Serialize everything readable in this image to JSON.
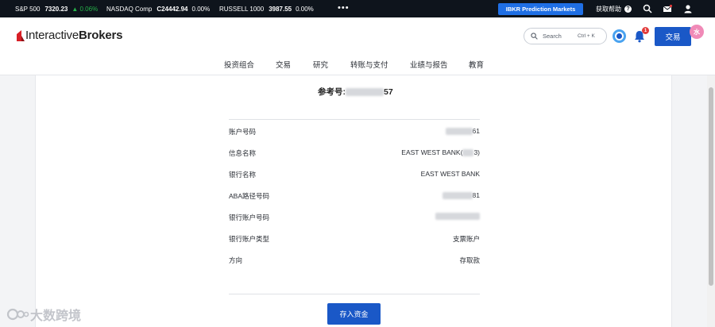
{
  "ticker": [
    {
      "name": "S&P 500",
      "value": "7320.23",
      "change": "▲ 0.06%",
      "up": true
    },
    {
      "name": "NASDAQ Comp",
      "value": "C24442.94",
      "change": "0.00%",
      "up": false
    },
    {
      "name": "RUSSELL 1000",
      "value": "3987.55",
      "change": "0.00%",
      "up": false
    }
  ],
  "topbar": {
    "more": "•••",
    "prediction_label": "IBKR Prediction Markets",
    "help_label": "获取帮助",
    "help_icon": "?"
  },
  "header": {
    "logo_regular": "Interactive",
    "logo_bold": "Brokers",
    "search_placeholder": "Search",
    "search_shortcut": "Ctrl + K",
    "notification_count": "1",
    "trade_label": "交易",
    "avatar_glyph": "水"
  },
  "nav": [
    "投资组合",
    "交易",
    "研究",
    "转账与支付",
    "业绩与报告",
    "教育"
  ],
  "detail": {
    "reference_label": "参考号:",
    "reference_suffix": "57",
    "rows": [
      {
        "label": "账户号码",
        "value": "61"
      },
      {
        "label": "信息名称",
        "value": "EAST WEST BANK(",
        "value_tail": "3)"
      },
      {
        "label": "银行名称",
        "value": "EAST WEST BANK"
      },
      {
        "label": "ABA路径号码",
        "value": "81"
      },
      {
        "label": "银行账户号码",
        "value": ""
      },
      {
        "label": "银行账户类型",
        "value": "支票账户"
      },
      {
        "label": "方向",
        "value": "存取款"
      }
    ],
    "deposit_label": "存入资金"
  },
  "watermark": "大数跨境",
  "colors": {
    "accent": "#1a58c7",
    "positive": "#26b34a",
    "badge": "#e23b3b"
  }
}
